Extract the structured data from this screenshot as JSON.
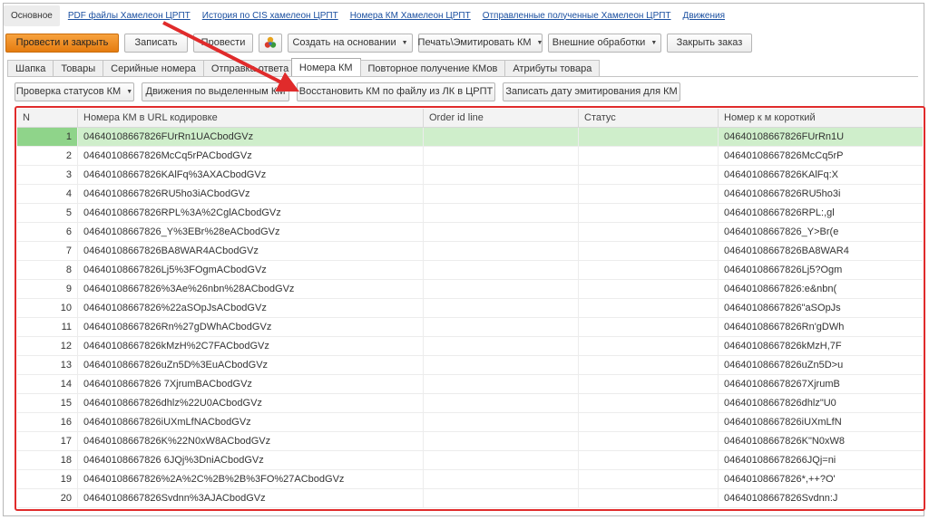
{
  "nav": [
    {
      "label": "Основное",
      "active": true
    },
    {
      "label": "PDF файлы  Хамелеон ЦРПТ"
    },
    {
      "label": "История по CIS хамелеон ЦРПТ"
    },
    {
      "label": "Номера КМ Хамелеон ЦРПТ"
    },
    {
      "label": "Отправленные полученные Хамелеон ЦРПТ"
    },
    {
      "label": "Движения"
    }
  ],
  "toolbar": {
    "post_close": "Провести и закрыть",
    "save": "Записать",
    "post": "Провести",
    "create_based": "Создать на основании",
    "print": "Печать\\Эмитировать КМ",
    "external": "Внешние обработки",
    "close_order": "Закрыть заказ"
  },
  "tabs": [
    {
      "label": "Шапка"
    },
    {
      "label": "Товары"
    },
    {
      "label": "Серийные номера"
    },
    {
      "label": "Отправка ответа"
    },
    {
      "label": "Номера КМ",
      "active": true
    },
    {
      "label": "Повторное получение КМов"
    },
    {
      "label": "Атрибуты товара"
    }
  ],
  "subbar": {
    "check_status": "Проверка статусов КМ",
    "movements": "Движения по выделенным КМ",
    "restore": "Восстановить КМ по файлу из ЛК в ЦРПТ",
    "write_date": "Записать дату эмитирования для КМ"
  },
  "table": {
    "headers": [
      "N",
      "Номера КМ в URL кодировке",
      "Order id line",
      "Статус",
      "Номер к м короткий"
    ],
    "rows": [
      {
        "n": "1",
        "url": "04640108667826FUrRn1UACbodGVz",
        "order": "",
        "status": "",
        "short": "04640108667826FUrRn1U"
      },
      {
        "n": "2",
        "url": "04640108667826McCq5rPACbodGVz",
        "order": "",
        "status": "",
        "short": "04640108667826McCq5rP"
      },
      {
        "n": "3",
        "url": "04640108667826KAlFq%3AXACbodGVz",
        "order": "",
        "status": "",
        "short": "04640108667826KAlFq:X"
      },
      {
        "n": "4",
        "url": "04640108667826RU5ho3iACbodGVz",
        "order": "",
        "status": "",
        "short": "04640108667826RU5ho3i"
      },
      {
        "n": "5",
        "url": "04640108667826RPL%3A%2CglACbodGVz",
        "order": "",
        "status": "",
        "short": "04640108667826RPL:,gl"
      },
      {
        "n": "6",
        "url": "04640108667826_Y%3EBr%28eACbodGVz",
        "order": "",
        "status": "",
        "short": "04640108667826_Y>Br(e"
      },
      {
        "n": "7",
        "url": "04640108667826BA8WAR4ACbodGVz",
        "order": "",
        "status": "",
        "short": "04640108667826BA8WAR4"
      },
      {
        "n": "8",
        "url": "04640108667826Lj5%3FOgmACbodGVz",
        "order": "",
        "status": "",
        "short": "04640108667826Lj5?Ogm"
      },
      {
        "n": "9",
        "url": "04640108667826%3Ae%26nbn%28ACbodGVz",
        "order": "",
        "status": "",
        "short": "04640108667826:e&nbn("
      },
      {
        "n": "10",
        "url": "04640108667826%22aSOpJsACbodGVz",
        "order": "",
        "status": "",
        "short": "04640108667826\"aSOpJs"
      },
      {
        "n": "11",
        "url": "04640108667826Rn%27gDWhACbodGVz",
        "order": "",
        "status": "",
        "short": "04640108667826Rn'gDWh"
      },
      {
        "n": "12",
        "url": "04640108667826kMzH%2C7FACbodGVz",
        "order": "",
        "status": "",
        "short": "04640108667826kMzH,7F"
      },
      {
        "n": "13",
        "url": "04640108667826uZn5D%3EuACbodGVz",
        "order": "",
        "status": "",
        "short": "04640108667826uZn5D>u"
      },
      {
        "n": "14",
        "url": "04640108667826 7XjrumBACbodGVz",
        "order": "",
        "status": "",
        "short": "046401086678267XjrumB"
      },
      {
        "n": "15",
        "url": "04640108667826dhlz%22U0ACbodGVz",
        "order": "",
        "status": "",
        "short": "04640108667826dhlz\"U0"
      },
      {
        "n": "16",
        "url": "04640108667826iUXmLfNACbodGVz",
        "order": "",
        "status": "",
        "short": "04640108667826iUXmLfN"
      },
      {
        "n": "17",
        "url": "04640108667826K%22N0xW8ACbodGVz",
        "order": "",
        "status": "",
        "short": "04640108667826K\"N0xW8"
      },
      {
        "n": "18",
        "url": "04640108667826 6JQj%3DniACbodGVz",
        "order": "",
        "status": "",
        "short": "046401086678266JQj=ni"
      },
      {
        "n": "19",
        "url": "04640108667826%2A%2C%2B%2B%3FO%27ACbodGVz",
        "order": "",
        "status": "",
        "short": "04640108667826*,++?O'"
      },
      {
        "n": "20",
        "url": "04640108667826Svdnn%3AJACbodGVz",
        "order": "",
        "status": "",
        "short": "04640108667826Svdnn:J"
      }
    ]
  },
  "colors": {
    "primary_button": "#f28c1e",
    "selected_row": "#cfeecb",
    "highlight_border": "#e02b2b",
    "link": "#1a4fa0"
  },
  "icons": {
    "report": "colored-circles-icon",
    "dropdown": "chevron-down-icon",
    "annotation": "red-arrow"
  }
}
